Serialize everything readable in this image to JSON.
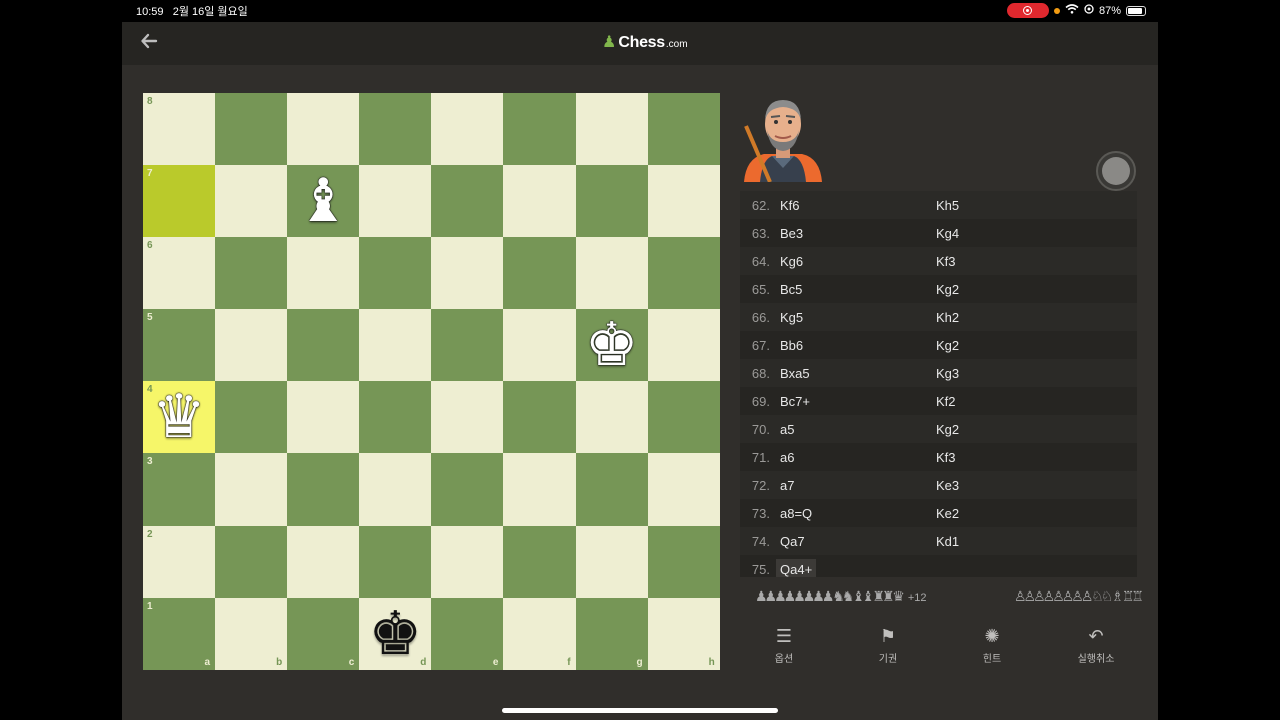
{
  "statusbar": {
    "time": "10:59",
    "date": "2월 16일 월요일",
    "battery": "87%",
    "battery_level": 0.87
  },
  "header": {
    "logo_main": "Chess",
    "logo_suffix": ".com"
  },
  "board": {
    "ranks": [
      "8",
      "7",
      "6",
      "5",
      "4",
      "3",
      "2",
      "1"
    ],
    "files": [
      "a",
      "b",
      "c",
      "d",
      "e",
      "f",
      "g",
      "h"
    ],
    "highlighted_squares": [
      "a7",
      "a4"
    ],
    "pieces": [
      {
        "square": "c7",
        "color": "white",
        "type": "bishop",
        "glyph": "♝"
      },
      {
        "square": "g5",
        "color": "white",
        "type": "king",
        "glyph": "♚"
      },
      {
        "square": "a4",
        "color": "white",
        "type": "queen",
        "glyph": "♛"
      },
      {
        "square": "d1",
        "color": "black",
        "type": "king",
        "glyph": "♚"
      }
    ]
  },
  "moves": [
    {
      "num": "62.",
      "white": "Kf6",
      "black": "Kh5"
    },
    {
      "num": "63.",
      "white": "Be3",
      "black": "Kg4"
    },
    {
      "num": "64.",
      "white": "Kg6",
      "black": "Kf3"
    },
    {
      "num": "65.",
      "white": "Bc5",
      "black": "Kg2"
    },
    {
      "num": "66.",
      "white": "Kg5",
      "black": "Kh2"
    },
    {
      "num": "67.",
      "white": "Bb6",
      "black": "Kg2"
    },
    {
      "num": "68.",
      "white": "Bxa5",
      "black": "Kg3"
    },
    {
      "num": "69.",
      "white": "Bc7+",
      "black": "Kf2"
    },
    {
      "num": "70.",
      "white": "a5",
      "black": "Kg2"
    },
    {
      "num": "71.",
      "white": "a6",
      "black": "Kf3"
    },
    {
      "num": "72.",
      "white": "a7",
      "black": "Ke3"
    },
    {
      "num": "73.",
      "white": "a8=Q",
      "black": "Ke2"
    },
    {
      "num": "74.",
      "white": "Qa7",
      "black": "Kd1"
    },
    {
      "num": "75.",
      "white": "Qa4+",
      "black": ""
    }
  ],
  "captured": {
    "left": "♟♟♟♟♟♟♟♟ ♞♞ ♝♝ ♜♜ ♛",
    "left_score": "+12",
    "right": "♙♙♙♙♙♙♙♙ ♘♘ ♗ ♖♖"
  },
  "actions": [
    {
      "label": "옵션",
      "icon": "menu-icon",
      "glyph": "☰"
    },
    {
      "label": "기권",
      "icon": "flag-icon",
      "glyph": "⚑"
    },
    {
      "label": "힌트",
      "icon": "lightbulb-icon",
      "glyph": "✺"
    },
    {
      "label": "실행취소",
      "icon": "undo-icon",
      "glyph": "↶"
    }
  ],
  "colors": {
    "light_square": "#eeeed2",
    "dark_square": "#769656",
    "highlight_light": "#f6f669",
    "highlight_dark": "#baca2b",
    "brand_green": "#81b64c",
    "record": "#e0282e"
  }
}
